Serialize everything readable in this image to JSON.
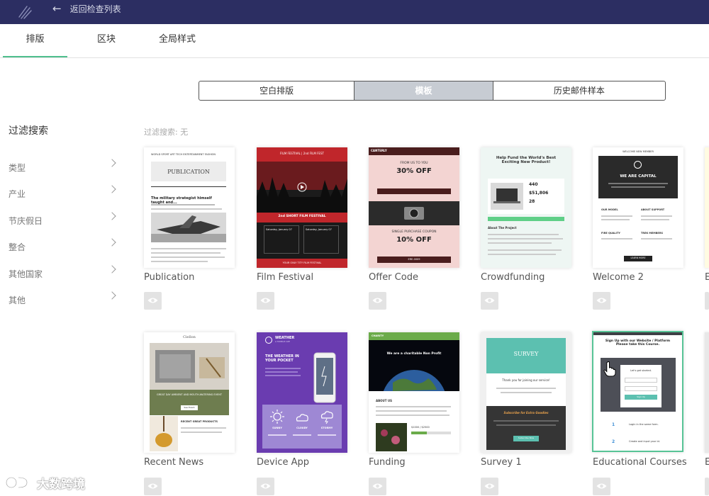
{
  "topbar": {
    "back_label": "返回检查列表"
  },
  "tabs": [
    {
      "label": "排版",
      "active": true
    },
    {
      "label": "区块",
      "active": false
    },
    {
      "label": "全局样式",
      "active": false
    }
  ],
  "source_switch": [
    {
      "label": "空白排版",
      "active": false
    },
    {
      "label": "模板",
      "active": true
    },
    {
      "label": "历史邮件样本",
      "active": false
    }
  ],
  "filter": {
    "title": "过滤搜索",
    "status": "过滤搜索: 无",
    "categories": [
      "类型",
      "产业",
      "节庆假日",
      "整合",
      "其他国家",
      "其他"
    ]
  },
  "templates": [
    {
      "name": "Publication"
    },
    {
      "name": "Film Festival"
    },
    {
      "name": "Offer Code"
    },
    {
      "name": "Crowdfunding"
    },
    {
      "name": "Welcome 2"
    },
    {
      "name": "E"
    },
    {
      "name": "Recent News"
    },
    {
      "name": "Device App"
    },
    {
      "name": "Funding"
    },
    {
      "name": "Survey 1"
    },
    {
      "name": "Educational Courses",
      "selected": true
    },
    {
      "name": "E"
    }
  ],
  "previews": {
    "publication": {
      "title": "PUBLICATION",
      "nav": "WORLD   SPORT   ART   TECH   ENTERTAINMENT   FASHION",
      "heading": "The military strategist himself taught and..."
    },
    "film": {
      "title": "2nd SHORT FILM FESTIVAL",
      "header": "FILM FESTIVAL | 2nd FILM FEST",
      "date1": "Saturday, January 07",
      "date2": "Saturday, January 07",
      "footer": "YOUR ONLY TITY FILM FESTIVAL"
    },
    "offer": {
      "brand": "CANTERLY",
      "line1": "FROM US TO YOU",
      "big1": "30% OFF",
      "line2": "SINGLE PURCHASE COUPON",
      "big2": "10% OFF",
      "code": "ERE-0009"
    },
    "crowd": {
      "title": "Help Fund the World's Best Exciting New Product!",
      "s1": "440",
      "s2": "$51,806",
      "s3": "28",
      "section": "About The Project"
    },
    "welcome": {
      "top": "WELCOME NEW MEMBER",
      "hero": "WE ARE CAPITAL",
      "c1": "OUR MODEL",
      "c2": "ABOUT SUPPORT",
      "c3": "FIRE QUALITY",
      "c4": "TREK MEMBERS",
      "cta": "LEARN MORE"
    },
    "news": {
      "brand": "Ciellon",
      "band": "GREAT DAY AMBIENT AND MOUTH-WATERING EVENT",
      "btn": "See Event",
      "section": "RECENT GREAT PRODUCTS"
    },
    "weather": {
      "brand": "WEATHER",
      "sub": "A MOBILE APP",
      "headline": "THE WEATHER IN YOUR POCKET",
      "d1": "SUNNY",
      "d2": "CLOUDY",
      "d3": "STORMY"
    },
    "funding": {
      "brand": "CHARITY",
      "headline": "We are a charitable Non Profit",
      "about": "ABOUT US",
      "goal": "$1000 / $2500"
    },
    "survey": {
      "title": "SURVEY",
      "thanks": "Thank you for joining our service!",
      "sub": "Subscribe for Extra Goodies",
      "btn": "Subscribe Now"
    },
    "edu": {
      "title": "Sign Up with our Website / Platform Please take this Course.",
      "card": "Let's get started.",
      "btn": "Sign Up",
      "s1": "Login in the same form.",
      "s2": "Create and input your id."
    }
  },
  "watermark": {
    "text": "大数跨境"
  },
  "colors": {
    "topbar": "#2c2e62",
    "accent": "#4fbf8d",
    "segment_active": "#c7ccd3"
  }
}
